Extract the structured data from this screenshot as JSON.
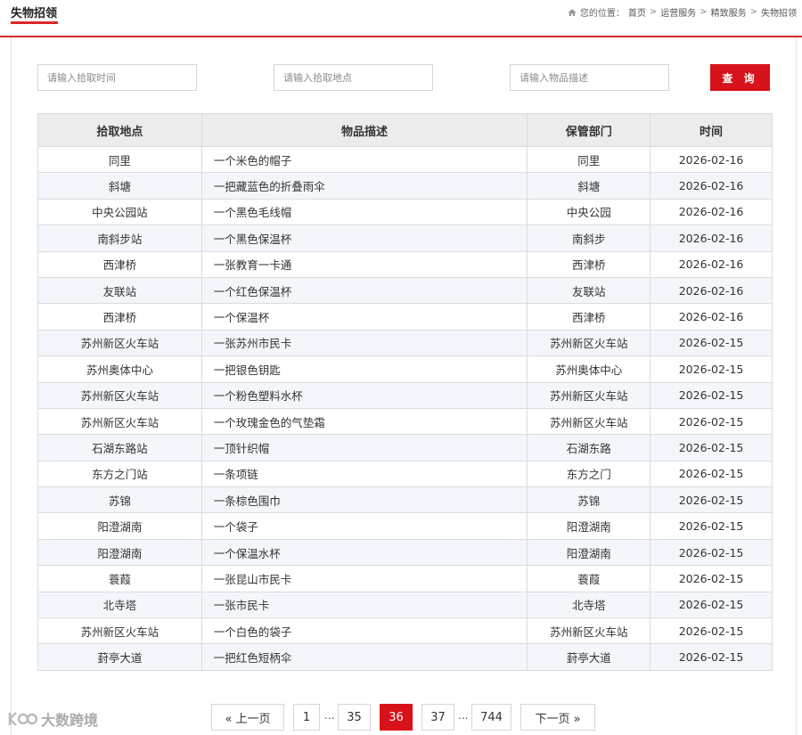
{
  "header": {
    "title": "失物招领",
    "breadcrumb": {
      "label": "您的位置：",
      "items": [
        "首页",
        "运营服务",
        "精致服务",
        "失物招领"
      ],
      "separator": ">"
    }
  },
  "search": {
    "time_placeholder": "请输入拾取时间",
    "place_placeholder": "请输入拾取地点",
    "desc_placeholder": "请输入物品描述",
    "button_label": "查 询"
  },
  "table": {
    "headers": [
      "拾取地点",
      "物品描述",
      "保管部门",
      "时间"
    ],
    "rows": [
      [
        "同里",
        "一个米色的帽子",
        "同里",
        "2026-02-16"
      ],
      [
        "斜塘",
        "一把藏蓝色的折叠雨伞",
        "斜塘",
        "2026-02-16"
      ],
      [
        "中央公园站",
        "一个黑色毛线帽",
        "中央公园",
        "2026-02-16"
      ],
      [
        "南斜步站",
        "一个黑色保温杯",
        "南斜步",
        "2026-02-16"
      ],
      [
        "西津桥",
        "一张教育一卡通",
        "西津桥",
        "2026-02-16"
      ],
      [
        "友联站",
        "一个红色保温杯",
        "友联站",
        "2026-02-16"
      ],
      [
        "西津桥",
        "一个保温杯",
        "西津桥",
        "2026-02-16"
      ],
      [
        "苏州新区火车站",
        "一张苏州市民卡",
        "苏州新区火车站",
        "2026-02-15"
      ],
      [
        "苏州奥体中心",
        "一把银色钥匙",
        "苏州奥体中心",
        "2026-02-15"
      ],
      [
        "苏州新区火车站",
        "一个粉色塑料水杯",
        "苏州新区火车站",
        "2026-02-15"
      ],
      [
        "苏州新区火车站",
        "一个玫瑰金色的气垫霜",
        "苏州新区火车站",
        "2026-02-15"
      ],
      [
        "石湖东路站",
        "一顶针织帽",
        "石湖东路",
        "2026-02-15"
      ],
      [
        "东方之门站",
        "一条项链",
        "东方之门",
        "2026-02-15"
      ],
      [
        "苏锦",
        "一条棕色围巾",
        "苏锦",
        "2026-02-15"
      ],
      [
        "阳澄湖南",
        "一个袋子",
        "阳澄湖南",
        "2026-02-15"
      ],
      [
        "阳澄湖南",
        "一个保温水杯",
        "阳澄湖南",
        "2026-02-15"
      ],
      [
        "蓑葭",
        "一张昆山市民卡",
        "蓑葭",
        "2026-02-15"
      ],
      [
        "北寺塔",
        "一张市民卡",
        "北寺塔",
        "2026-02-15"
      ],
      [
        "苏州新区火车站",
        "一个白色的袋子",
        "苏州新区火车站",
        "2026-02-15"
      ],
      [
        "葑亭大道",
        "一把红色短柄伞",
        "葑亭大道",
        "2026-02-15"
      ]
    ]
  },
  "pagination": {
    "prev_label": "« 上一页",
    "next_label": "下一页 »",
    "pages": [
      "1",
      "35",
      "36",
      "37",
      "744"
    ],
    "current": "36",
    "ellipsis": "..."
  },
  "watermark": {
    "text": "大数跨境"
  },
  "colors": {
    "accent": "#d8121a",
    "header_bg": "#ececec",
    "stripe": "#f3f6fb"
  }
}
